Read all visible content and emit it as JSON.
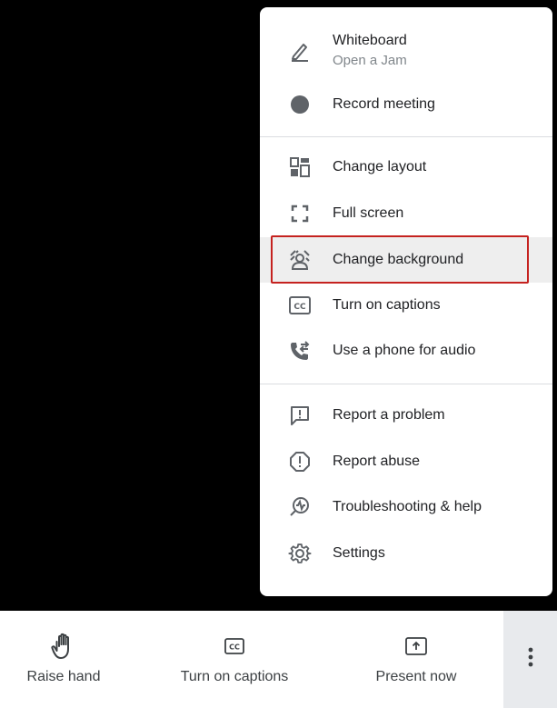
{
  "menu": {
    "items": [
      {
        "label": "Whiteboard",
        "sublabel": "Open a Jam",
        "icon": "pencil-icon"
      },
      {
        "label": "Record meeting",
        "icon": "record-dot-icon"
      },
      {
        "label": "Change layout",
        "icon": "layout-icon"
      },
      {
        "label": "Full screen",
        "icon": "fullscreen-icon"
      },
      {
        "label": "Change background",
        "icon": "background-person-icon",
        "highlighted": true
      },
      {
        "label": "Turn on captions",
        "icon": "captions-icon"
      },
      {
        "label": "Use a phone for audio",
        "icon": "phone-audio-icon"
      },
      {
        "label": "Report a problem",
        "icon": "report-problem-icon"
      },
      {
        "label": "Report abuse",
        "icon": "report-abuse-icon"
      },
      {
        "label": "Troubleshooting & help",
        "icon": "troubleshooting-icon"
      },
      {
        "label": "Settings",
        "icon": "gear-icon"
      }
    ]
  },
  "bottom_bar": {
    "raise_hand": {
      "label": "Raise hand",
      "icon": "hand-icon"
    },
    "captions": {
      "label": "Turn on captions",
      "icon": "captions-icon"
    },
    "present": {
      "label": "Present now",
      "icon": "present-icon"
    },
    "more": {
      "icon": "more-vert-icon"
    }
  },
  "colors": {
    "highlight_border": "#c5221f",
    "icon": "#5f6368",
    "text": "#202124",
    "stage": "#000000"
  }
}
